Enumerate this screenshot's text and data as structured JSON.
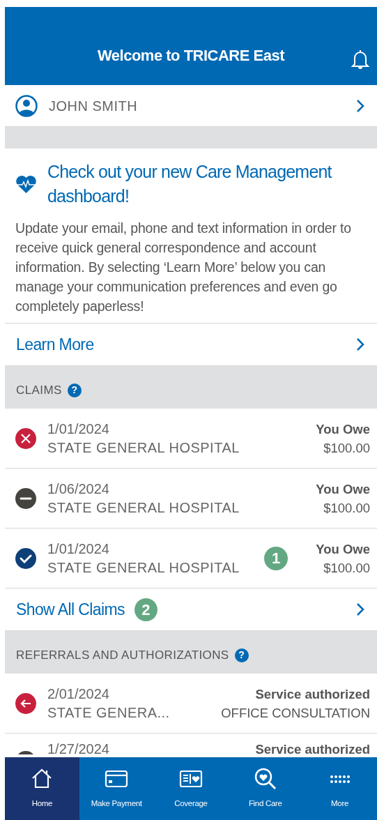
{
  "header": {
    "title": "Welcome to TRICARE East"
  },
  "user": {
    "name": "JOHN SMITH"
  },
  "promo": {
    "title": "Check out your new Care Management dashboard!",
    "body": "Update your email, phone and text information in order to receive quick general correspondence and account information. By selecting ‘Learn More’ below you can manage your communication preferences and even go completely paperless!",
    "link": "Learn More"
  },
  "claims": {
    "heading": "CLAIMS",
    "help": "?",
    "rows": [
      {
        "kind": "denied",
        "date": "1/01/2024",
        "provider": "STATE GENERAL HOSPITAL",
        "label": "You Owe",
        "amount": "$100.00"
      },
      {
        "kind": "pending",
        "date": "1/06/2024",
        "provider": "STATE GENERAL HOSPITAL",
        "label": "You Owe",
        "amount": "$100.00"
      },
      {
        "kind": "approved",
        "date": "1/01/2024",
        "provider": "STATE GENERAL HOSPITAL",
        "label": "You Owe",
        "amount": "$100.00",
        "marker": "1"
      }
    ],
    "link": "Show All Claims",
    "link_marker": "2"
  },
  "referrals": {
    "heading": "REFERRALS AND AUTHORIZATIONS",
    "help": "?",
    "rows": [
      {
        "kind": "outgoing",
        "date": "2/01/2024",
        "provider": "STATE GENERA...",
        "label": "Service authorized",
        "detail": "OFFICE CONSULTATION"
      },
      {
        "kind": "pending",
        "partial": true,
        "date": "1/27/2024",
        "label": "Service authorized"
      }
    ]
  },
  "nav": [
    {
      "label": "Home",
      "selected": true
    },
    {
      "label": "Make Payment",
      "selected": false
    },
    {
      "label": "Coverage",
      "selected": false
    },
    {
      "label": "Find Care",
      "selected": false
    },
    {
      "label": "More",
      "selected": false
    }
  ]
}
